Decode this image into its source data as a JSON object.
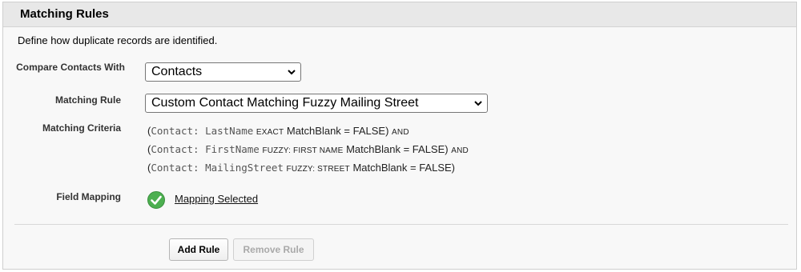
{
  "panel": {
    "title": "Matching Rules",
    "description": "Define how duplicate records are identified."
  },
  "form": {
    "compare_label": "Compare Contacts With",
    "compare_value": "Contacts",
    "rule_label": "Matching Rule",
    "rule_value": "Custom Contact Matching Fuzzy Mailing Street",
    "criteria_label": "Matching Criteria",
    "criteria": [
      {
        "open": "(",
        "field": "Contact: LastName",
        "method": "EXACT",
        "blank": "MatchBlank = FALSE",
        "close": ")",
        "joiner": "AND"
      },
      {
        "open": "(",
        "field": "Contact: FirstName",
        "method": "FUZZY: FIRST NAME",
        "blank": "MatchBlank = FALSE",
        "close": ")",
        "joiner": "AND"
      },
      {
        "open": "(",
        "field": "Contact: MailingStreet",
        "method": "FUZZY: STREET",
        "blank": "MatchBlank = FALSE",
        "close": ")",
        "joiner": ""
      }
    ],
    "mapping_label": "Field Mapping",
    "mapping_value": "Mapping Selected"
  },
  "buttons": {
    "add": "Add Rule",
    "remove": "Remove Rule"
  },
  "colors": {
    "check_green": "#4caf50"
  }
}
